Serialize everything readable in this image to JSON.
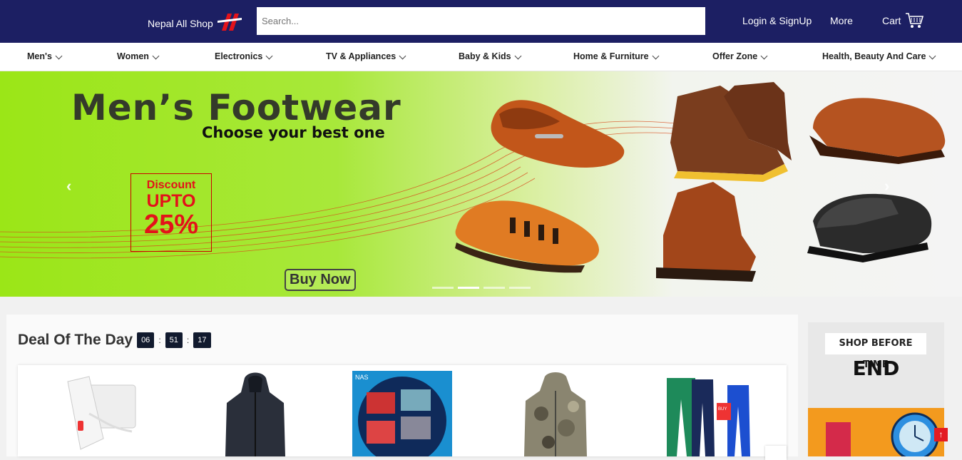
{
  "header": {
    "brand": "Nepal All Shop",
    "search_placeholder": "Search...",
    "login_label": "Login & SignUp",
    "more_label": "More",
    "cart_label": "Cart"
  },
  "categories": [
    {
      "label": "Men's"
    },
    {
      "label": "Women"
    },
    {
      "label": "Electronics"
    },
    {
      "label": "TV & Appliances"
    },
    {
      "label": "Baby & Kids"
    },
    {
      "label": "Home & Furniture"
    },
    {
      "label": "Offer Zone"
    },
    {
      "label": "Health, Beauty And Care"
    }
  ],
  "banner": {
    "title": "Men’s Footwear",
    "subtitle": "Choose your best one",
    "discount_line1": "Discount",
    "discount_line2": "UPTO",
    "discount_line3": "25%",
    "buy_label": "Buy Now",
    "prev_icon": "chevron-left-icon",
    "next_icon": "chevron-right-icon",
    "slide_count": 4,
    "active_slide": 2
  },
  "deal": {
    "title": "Deal Of The Day",
    "hours": "06",
    "minutes": "51",
    "seconds": "17",
    "products": [
      {
        "name": "power-bank"
      },
      {
        "name": "black-jacket"
      },
      {
        "name": "boxer-shorts"
      },
      {
        "name": "camo-jacket"
      },
      {
        "name": "track-pants"
      }
    ]
  },
  "side_ad": {
    "top_text": "SHOP BEFORE TIME",
    "end_text": "END"
  },
  "colors": {
    "topbar": "#1c1f63",
    "accent_red": "#e3121a",
    "timer_box": "#111a2e"
  }
}
